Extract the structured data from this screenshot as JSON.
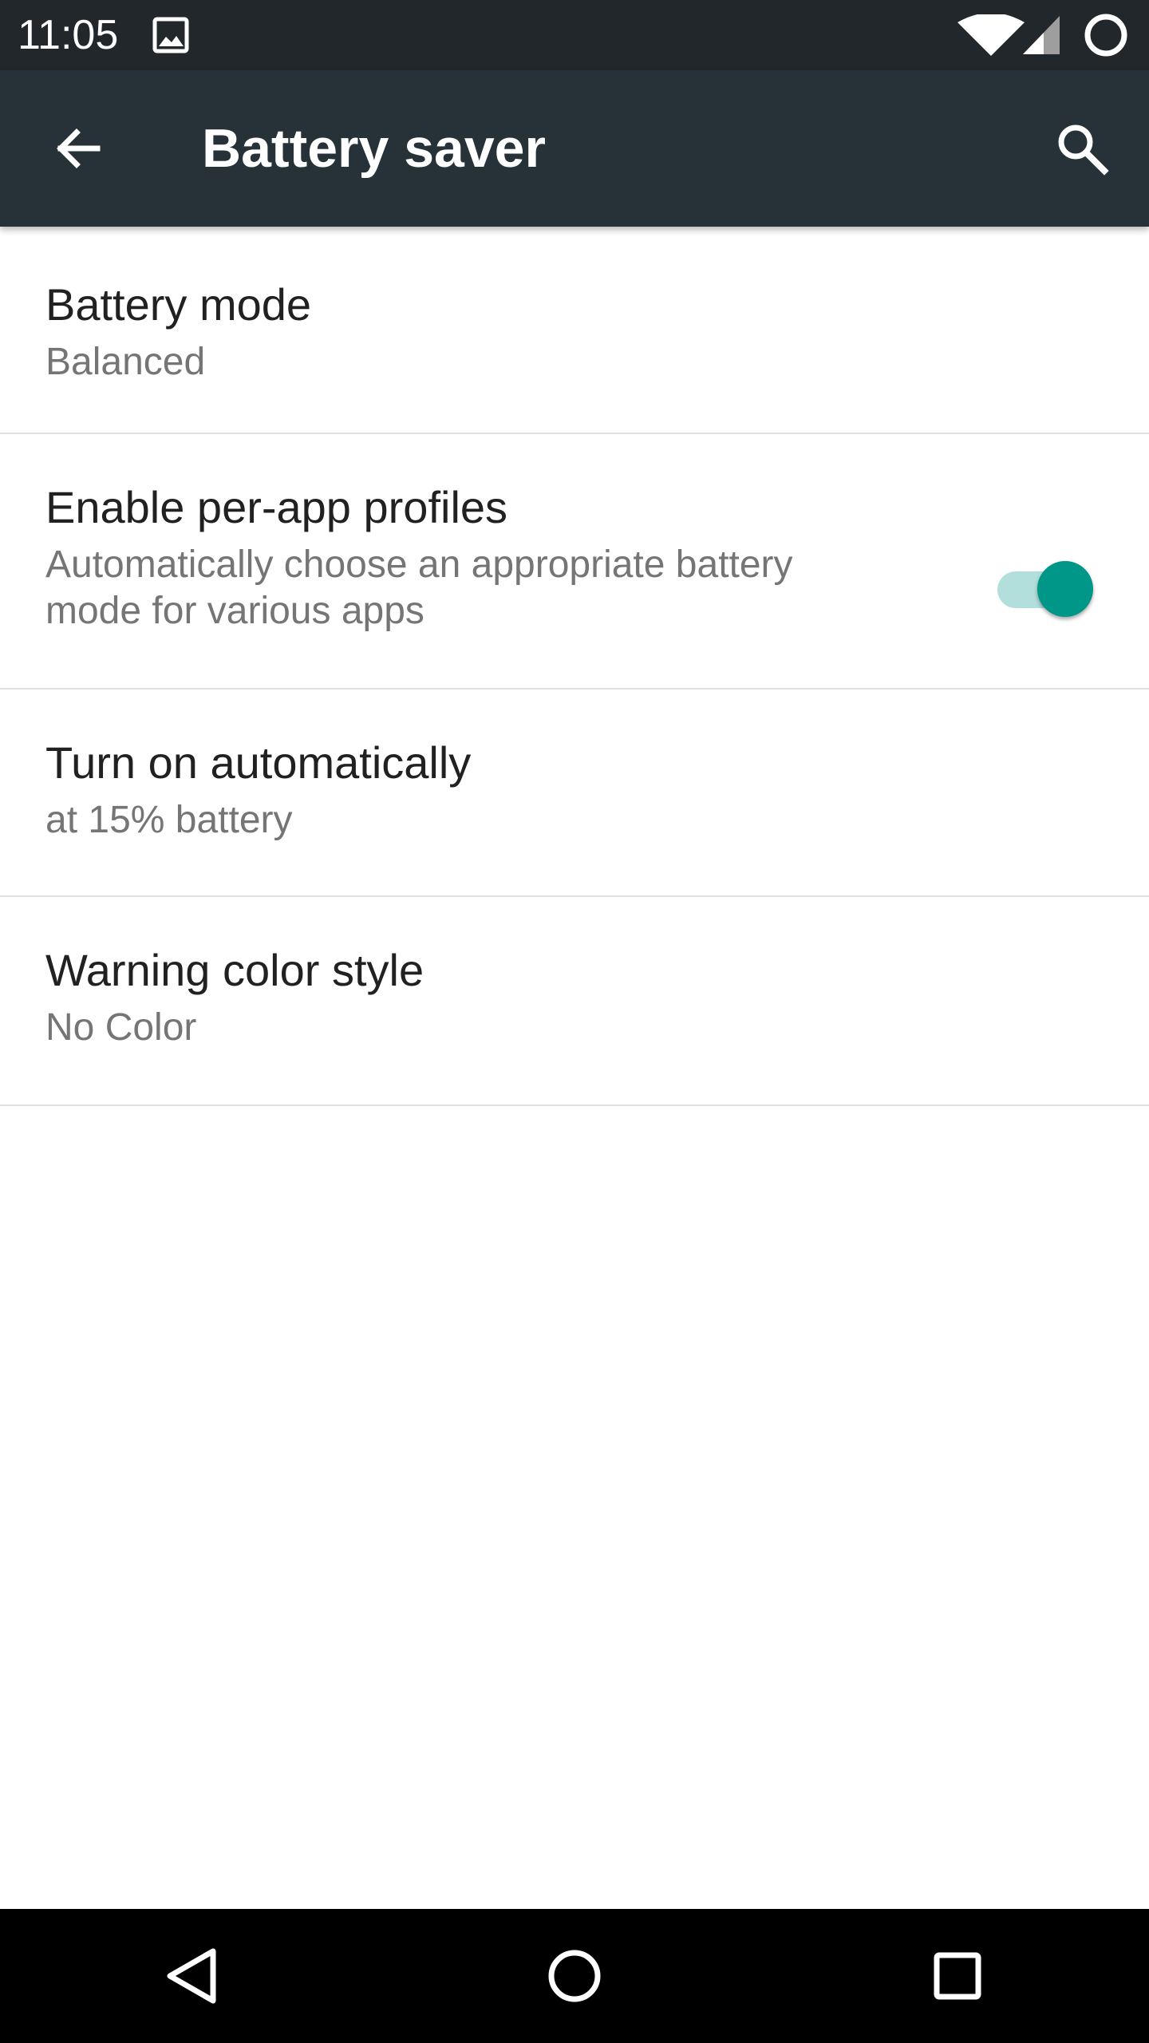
{
  "status_bar": {
    "time": "11:05",
    "icons": [
      "image-notification-icon",
      "wifi-icon",
      "cell-signal-icon",
      "battery-saver-icon"
    ]
  },
  "toolbar": {
    "title": "Battery saver",
    "back_icon": "arrow-back-icon",
    "search_icon": "search-icon",
    "background_color": "#263238"
  },
  "settings": {
    "battery_mode": {
      "title": "Battery mode",
      "summary": "Balanced"
    },
    "per_app_profiles": {
      "title": "Enable per-app profiles",
      "summary_line1": "Automatically choose an appropriate battery",
      "summary_line2": "mode for various apps",
      "enabled": true,
      "accent_color": "#009688"
    },
    "turn_on_automatically": {
      "title": "Turn on automatically",
      "summary": "at 15% battery"
    },
    "warning_color_style": {
      "title": "Warning color style",
      "summary": "No Color"
    }
  },
  "nav_bar": {
    "buttons": [
      "back-triangle-icon",
      "home-circle-icon",
      "recents-square-icon"
    ]
  }
}
